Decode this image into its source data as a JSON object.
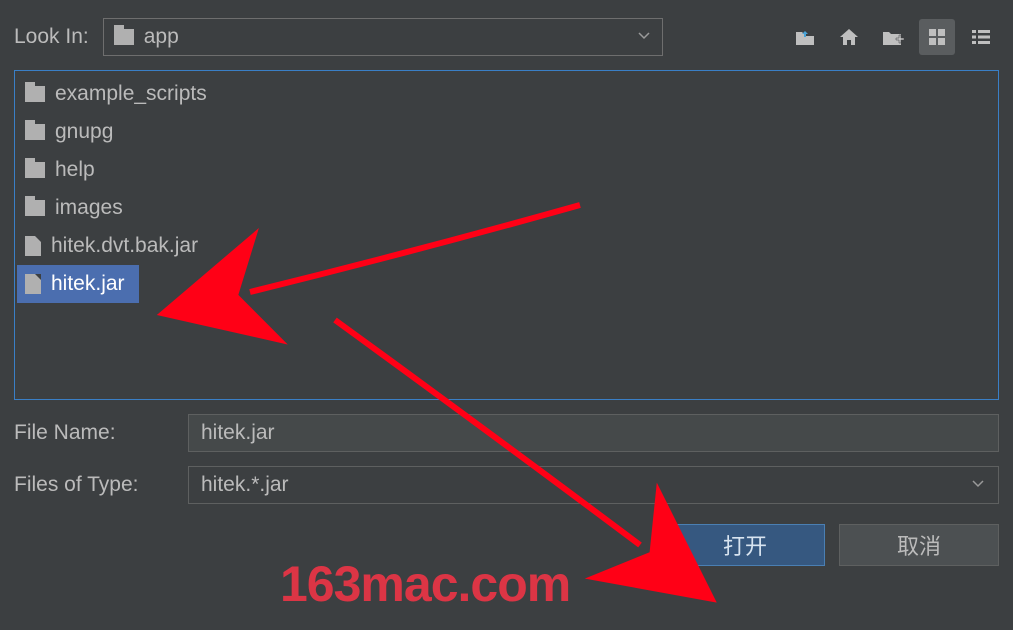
{
  "look_in": {
    "label": "Look In:",
    "value": "app"
  },
  "toolbar_icons": {
    "up": "up-level-icon",
    "home": "home-icon",
    "newfolder": "new-folder-icon",
    "grid": "grid-view-icon",
    "list": "list-view-icon"
  },
  "files": [
    {
      "name": "example_scripts",
      "type": "folder",
      "selected": false
    },
    {
      "name": "gnupg",
      "type": "folder",
      "selected": false
    },
    {
      "name": "help",
      "type": "folder",
      "selected": false
    },
    {
      "name": "images",
      "type": "folder",
      "selected": false
    },
    {
      "name": "hitek.dvt.bak.jar",
      "type": "file",
      "selected": false
    },
    {
      "name": "hitek.jar",
      "type": "file",
      "selected": true
    }
  ],
  "filename": {
    "label": "File Name:",
    "value": "hitek.jar"
  },
  "filetype": {
    "label": "Files of Type:",
    "value": "hitek.*.jar"
  },
  "buttons": {
    "open": "打开",
    "cancel": "取消"
  },
  "watermark": "163mac.com"
}
